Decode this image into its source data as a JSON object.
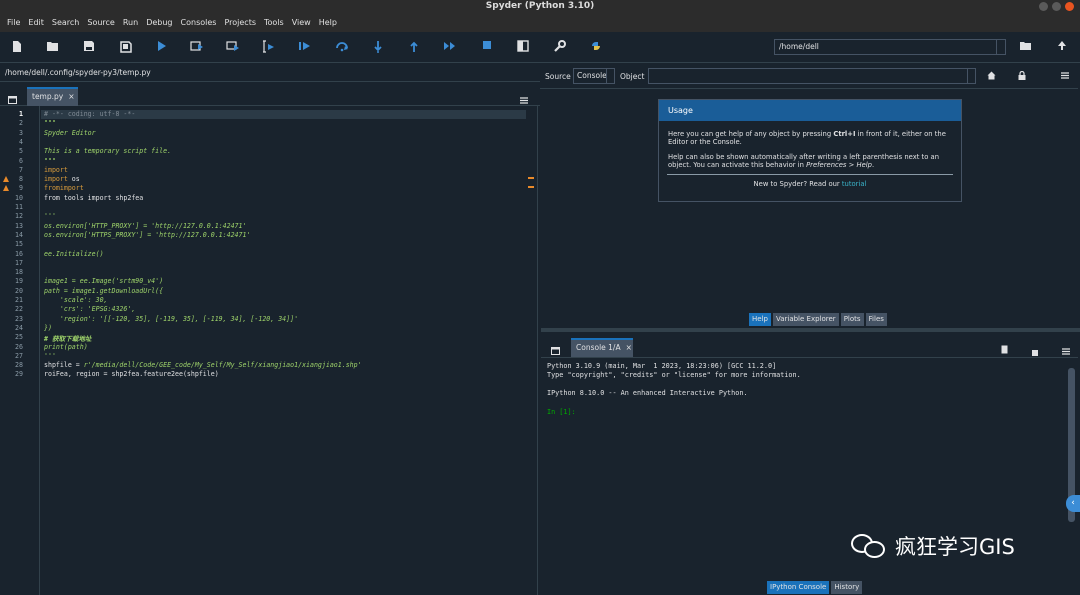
{
  "window": {
    "title": "Spyder (Python 3.10)"
  },
  "menu": [
    "File",
    "Edit",
    "Search",
    "Source",
    "Run",
    "Debug",
    "Consoles",
    "Projects",
    "Tools",
    "View",
    "Help"
  ],
  "toolbar": {
    "icons": [
      "new-file-icon",
      "open-folder-icon",
      "save-icon",
      "save-all-icon",
      "run-icon",
      "run-cell-icon",
      "run-cell-advance-icon",
      "run-selection-icon",
      "debug-icon",
      "step-over-icon",
      "step-into-icon",
      "step-return-icon",
      "continue-icon",
      "stop-icon",
      "maximize-pane-icon",
      "preferences-wrench-icon",
      "python-path-icon"
    ],
    "working_dir": "/home/dell"
  },
  "editor": {
    "file_path": "/home/dell/.config/spyder-py3/temp.py",
    "tab_label": "temp.py",
    "tab_close": "×",
    "current_line": 1,
    "warning_lines": [
      8,
      9
    ],
    "lines": [
      "# -*- coding: utf-8 -*-",
      "\"\"\"",
      "Spyder Editor",
      "",
      "This is a temporary script file.",
      "\"\"\"",
      "",
      "import os",
      "import ee",
      "from tools import shp2fea",
      "",
      "'''",
      "os.environ['HTTP_PROXY'] = 'http://127.0.0.1:42471'",
      "os.environ['HTTPS_PROXY'] = 'http://127.0.0.1:42471'",
      "",
      "ee.Initialize()",
      "",
      "",
      "image1 = ee.Image('srtm90_v4')",
      "path = image1.getDownloadUrl({",
      "    'scale': 30,",
      "    'crs': 'EPSG:4326',",
      "    'region': '[[-120, 35], [-119, 35], [-119, 34], [-120, 34]]'",
      "})",
      "# 获取下载地址",
      "print(path)",
      "'''",
      "shpfile = r'/media/dell/Code/GEE_code/My_Self/My_Self/xiangjiao1/xiangjiao1.shp'",
      "roiFea, region = shp2fea.feature2ee(shpfile)"
    ]
  },
  "help": {
    "source_label": "Source",
    "source_value": "Console",
    "object_label": "Object",
    "usage_title": "Usage",
    "para1_pre": "Here you can get help of any object by pressing ",
    "para1_key": "Ctrl+I",
    "para1_post": " in front of it, either on the Editor or the Console.",
    "para2_pre": "Help can also be shown automatically after writing a left parenthesis next to an object. You can activate this behavior in ",
    "para2_em": "Preferences > Help",
    "para2_post": ".",
    "newto": "New to Spyder? Read our ",
    "tutorial": "tutorial",
    "tabs": [
      "Help",
      "Variable Explorer",
      "Plots",
      "Files"
    ]
  },
  "console": {
    "tab_label": "Console 1/A",
    "tab_close": "×",
    "lines": [
      "Python 3.10.9 (main, Mar  1 2023, 18:23:06) [GCC 11.2.0]",
      "Type \"copyright\", \"credits\" or \"license\" for more information.",
      "",
      "IPython 8.10.0 -- An enhanced Interactive Python.",
      "",
      "In [1]:"
    ],
    "tabs": [
      "IPython Console",
      "History"
    ]
  },
  "watermark": {
    "text": "疯狂学习GIS"
  },
  "colors": {
    "bg": "#19232d",
    "accent": "#1a72bb",
    "warning": "#e98a2a",
    "string": "#9ed36a",
    "keyword": "#d69a3c"
  }
}
